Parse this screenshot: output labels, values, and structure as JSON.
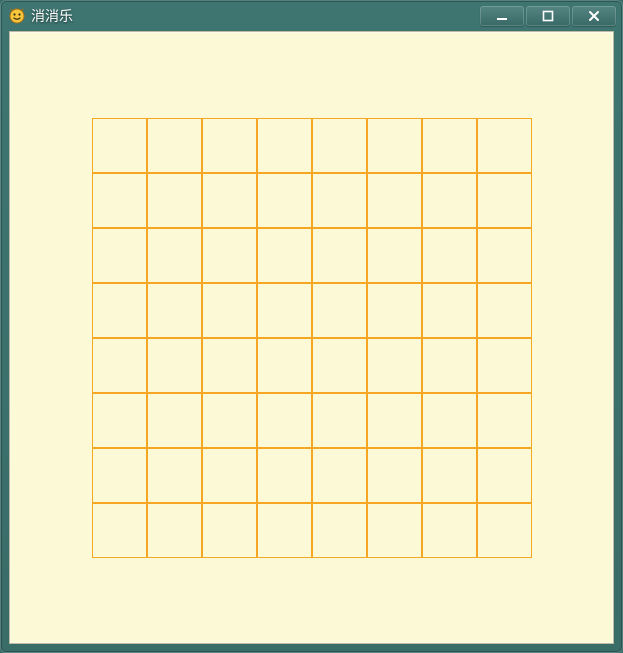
{
  "window": {
    "title": "消消乐",
    "icons": {
      "app": "app-icon",
      "minimize": "minimize-icon",
      "maximize": "maximize-icon",
      "close": "close-icon"
    }
  },
  "colors": {
    "frame_bg": "#3a6e6a",
    "client_bg": "#fbf9d6",
    "grid_line": "#f5a623"
  },
  "board": {
    "rows": 8,
    "cols": 8,
    "cell_size_px": 55,
    "cells": []
  }
}
